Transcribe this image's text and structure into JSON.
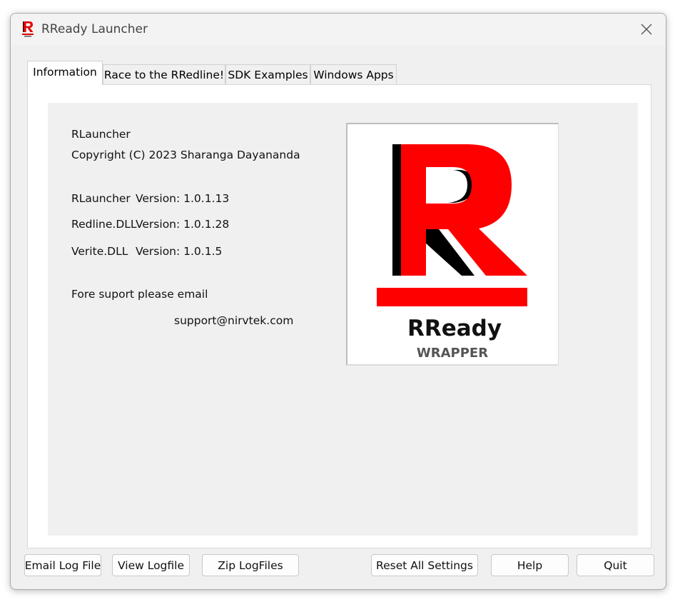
{
  "window": {
    "title": "RReady Launcher"
  },
  "tabs": [
    {
      "label": "Information",
      "active": true
    },
    {
      "label": "Race to the RRedline!",
      "active": false
    },
    {
      "label": "SDK Examples",
      "active": false
    },
    {
      "label": "Windows Apps",
      "active": false
    }
  ],
  "info": {
    "app_name": "RLauncher",
    "copyright": "Copyright (C) 2023 Sharanga Dayananda",
    "versions": [
      {
        "name": "RLauncher",
        "version": "Version: 1.0.1.13"
      },
      {
        "name": "Redline.DLL",
        "version": "Version: 1.0.1.28"
      },
      {
        "name": "Verite.DLL",
        "version": "Version: 1.0.1.5"
      }
    ],
    "support_prompt": "Fore suport please email",
    "support_email": "support@nirvtek.com"
  },
  "logo": {
    "title": "RReady",
    "subtitle": "WRAPPER",
    "letter": "R",
    "color_red": "#ff0000",
    "color_black": "#000000"
  },
  "buttons": {
    "email_log": "Email Log File",
    "view_log": "View Logfile",
    "zip_logs": "Zip LogFiles",
    "reset_settings": "Reset All Settings",
    "help": "Help",
    "quit": "Quit"
  },
  "icons": {
    "app": "rready-logo-icon",
    "close": "close-icon"
  }
}
